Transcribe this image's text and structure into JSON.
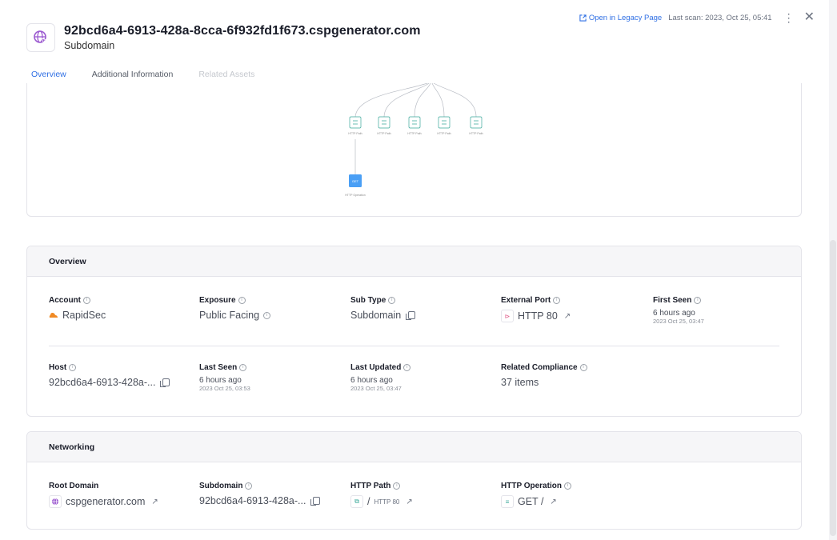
{
  "header": {
    "title": "92bcd6a4-6913-428a-8cca-6f932fd1f673.cspgenerator.com",
    "subtitle": "Subdomain",
    "legacy_link": "Open in Legacy Page",
    "last_scan": "Last scan: 2023, Oct 25, 05:41"
  },
  "tabs": [
    {
      "label": "Overview",
      "state": "active"
    },
    {
      "label": "Additional Information",
      "state": "normal"
    },
    {
      "label": "Related Assets",
      "state": "disabled"
    }
  ],
  "graph": {
    "path_nodes": [
      {
        "label": "HTTP Path"
      },
      {
        "label": "HTTP Path"
      },
      {
        "label": "HTTP Path"
      },
      {
        "label": "HTTP Path"
      },
      {
        "label": "HTTP Path"
      }
    ],
    "operation_node": {
      "badge": "GET",
      "label": "HTTP Operation"
    }
  },
  "overview": {
    "heading": "Overview",
    "account": {
      "label": "Account",
      "value": "RapidSec"
    },
    "exposure": {
      "label": "Exposure",
      "value": "Public Facing"
    },
    "sub_type": {
      "label": "Sub Type",
      "value": "Subdomain"
    },
    "external_port": {
      "label": "External Port",
      "value": "HTTP 80"
    },
    "first_seen": {
      "label": "First Seen",
      "value": "6 hours ago",
      "date": "2023 Oct 25, 03:47"
    },
    "host": {
      "label": "Host",
      "value": "92bcd6a4-6913-428a-..."
    },
    "last_seen": {
      "label": "Last Seen",
      "value": "6 hours ago",
      "date": "2023 Oct 25, 03:53"
    },
    "last_updated": {
      "label": "Last Updated",
      "value": "6 hours ago",
      "date": "2023 Oct 25, 03:47"
    },
    "related_compliance": {
      "label": "Related Compliance",
      "value": "37 items"
    }
  },
  "networking": {
    "heading": "Networking",
    "root_domain": {
      "label": "Root Domain",
      "value": "cspgenerator.com"
    },
    "subdomain": {
      "label": "Subdomain",
      "value": "92bcd6a4-6913-428a-..."
    },
    "http_path": {
      "label": "HTTP Path",
      "value": "/",
      "sub": "HTTP 80"
    },
    "http_operation": {
      "label": "HTTP Operation",
      "value": "GET /"
    }
  },
  "colors": {
    "accent": "#2f6fe4",
    "path_node": "#3aa89a",
    "operation_node": "#4a9ff5",
    "account_icon": "#f08a24",
    "domain_icon": "#9b59d0"
  }
}
